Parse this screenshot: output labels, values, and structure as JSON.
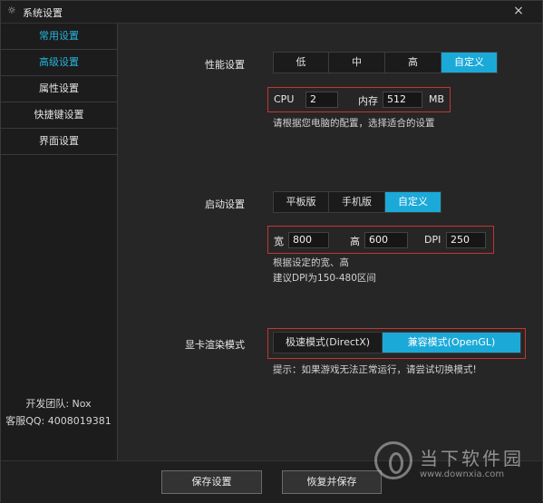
{
  "window": {
    "title": "系统设置",
    "title_icon": "gear-icon",
    "close_glyph": "×"
  },
  "sidebar": {
    "items": [
      {
        "label": "常用设置",
        "active": true
      },
      {
        "label": "高级设置",
        "active": true
      },
      {
        "label": "属性设置",
        "active": false
      },
      {
        "label": "快捷键设置",
        "active": false
      },
      {
        "label": "界面设置",
        "active": false
      }
    ],
    "footer": {
      "team": "开发团队: Nox",
      "service": "客服QQ: 4008019381"
    }
  },
  "performance": {
    "label": "性能设置",
    "options": [
      "低",
      "中",
      "高",
      "自定义"
    ],
    "selected": "自定义",
    "cpu_label": "CPU",
    "cpu_value": "2",
    "memory_label": "内存",
    "memory_value": "512",
    "memory_unit": "MB",
    "hint": "请根据您电脑的配置，选择适合的设置"
  },
  "startup": {
    "label": "启动设置",
    "options": [
      "平板版",
      "手机版",
      "自定义"
    ],
    "selected": "自定义",
    "width_label": "宽",
    "width_value": "800",
    "height_label": "高",
    "height_value": "600",
    "dpi_label": "DPI",
    "dpi_value": "250",
    "hint_1": "根据设定的宽、高",
    "hint_2": "建议DPI为150-480区间"
  },
  "render": {
    "label": "显卡渲染模式",
    "options": [
      "极速模式(DirectX)",
      "兼容模式(OpenGL)"
    ],
    "selected": "兼容模式(OpenGL)",
    "hint": "提示：如果游戏无法正常运行，请尝试切换模式!"
  },
  "footer_buttons": {
    "save": "保存设置",
    "restore": "恢复并保存"
  },
  "watermark": {
    "name": "当下软件园",
    "url": "www.downxia.com"
  },
  "colors": {
    "accent": "#1ba9d8",
    "highlight_box": "#c4352f",
    "active_text": "#27b3dd"
  }
}
